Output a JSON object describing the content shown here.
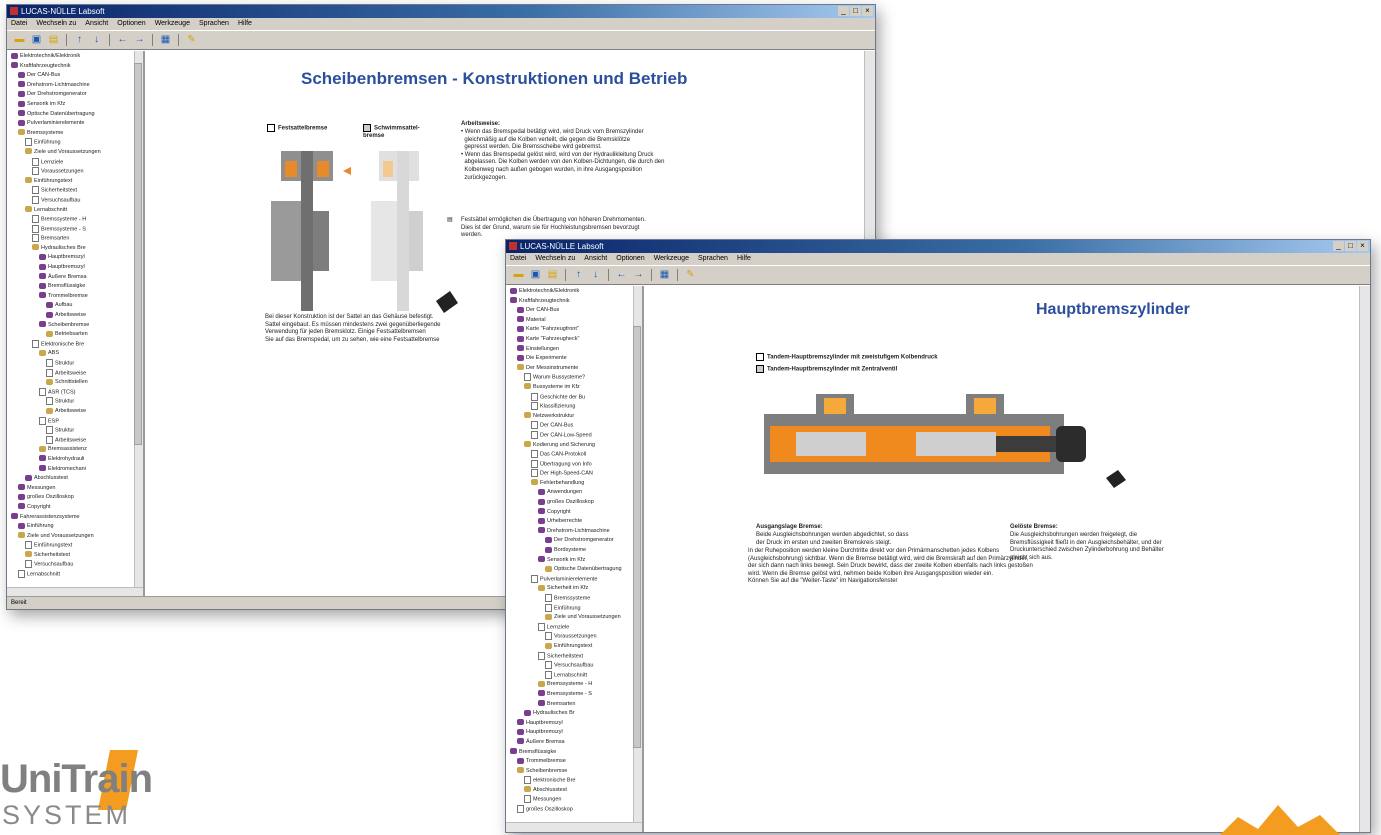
{
  "window1": {
    "title": "LUCAS-NÜLLE Labsoft",
    "menu": [
      "Datei",
      "Wechseln zu",
      "Ansicht",
      "Optionen",
      "Werkzeuge",
      "Sprachen",
      "Hilfe"
    ],
    "tree": [
      "Elektrotechnik/Elektronik",
      "Kraftfahrzeugtechnik",
      "Der CAN-Bus",
      "Drehstrom-Lichtmaschine",
      "Der Drehstromgenerator",
      "Sensorik im Kfz",
      "Optische Datenübertragung",
      "Pulverlaminierelemente",
      "Bremssysteme",
      "Einführung",
      "Ziele und Voraussetzungen",
      "Lernziele",
      "Voraussetzungen",
      "Einführungstext",
      "Sicherheitstext",
      "Versuchsaufbau",
      "Lernabschnitt",
      "Bremssysteme - H",
      "Bremssysteme - S",
      "Bremsarten",
      "Hydraulisches Bre",
      "Hauptbremszyl",
      "Hauptbremszyl",
      "Äußere Bremsa",
      "Bremsflüssigke",
      "Trommelbremse",
      "Aufbau",
      "Arbeitsweise",
      "Scheibenbremse",
      "Betriebsarten",
      "Elektronische Bre",
      "ABS",
      "Struktur",
      "Arbeitsweise",
      "Schnittstellen",
      "ASR (TCS)",
      "Struktur",
      "Arbeitsweise",
      "ESP",
      "Struktur",
      "Arbeitsweise",
      "Bremsassistenz",
      "Elektrohydrauli",
      "Elektromechani",
      "Abschlusstest",
      "Messungen",
      "großes Oszilloskop",
      "Copyright",
      "Fahrerassistenzsysteme",
      "Einführung",
      "Ziele und Voraussetzungen",
      "Einführungstext",
      "Sicherheitstext",
      "Versuchsaufbau",
      "Lernabschnitt"
    ],
    "status": "Bereit",
    "page": {
      "title": "Scheibenbremsen - Konstruktionen und Betrieb",
      "option1": "Festsattelbremse",
      "option2": "Schwimmsattel-bremse",
      "work_heading": "Arbeitsweise:",
      "work_lines": [
        "• Wenn das Bremspedal betätigt wird, wird Druck vom Bremszylinder",
        "  gleichmäßig auf die Kolben verteilt, die gegen die Bremsklötze",
        "  gepresst werden. Die Bremsscheibe wird gebremst.",
        "• Wenn das Bremspedal gelöst wird, wird von der Hydraulikleitung Druck",
        "  abgelassen. Die Kolben werden von den Kolben-Dichtungen, die durch den",
        "  Kolbenweg nach außen gebogen wurden, in ihre Ausgangsposition",
        "  zurückgezogen."
      ],
      "note_lines": [
        "Festsättel ermöglichen die Übertragung von höheren Drehmomenten.",
        "Dies ist der Grund, warum sie für Hochleistungsbremsen bevorzugt",
        "werden."
      ],
      "bottom_lines": [
        "Bei dieser Konstruktion ist der Sattel an das Gehäuse befestigt.",
        "Sattel eingebaut. Es müssen mindestens zwei gegenüberliegende",
        "Verwendung für jeden Bremsklotz. Einige Festsattelbremsen",
        "Sie auf das Bremspedal, um zu sehen, wie eine Festsattelbremse"
      ]
    }
  },
  "window2": {
    "title": "LUCAS-NÜLLE Labsoft",
    "menu": [
      "Datei",
      "Wechseln zu",
      "Ansicht",
      "Optionen",
      "Werkzeuge",
      "Sprachen",
      "Hilfe"
    ],
    "tree": [
      "Elektrotechnik/Elektronik",
      "Kraftfahrzeugtechnik",
      "Der CAN-Bus",
      "Material",
      "Karte \"Fahrzeugfront\"",
      "Karte \"Fahrzeugheck\"",
      "Einstellungen",
      "Die Experimente",
      "Der Messinstrumente",
      "Warum Bussysteme?",
      "Bussysteme im Kfz",
      "Geschichte der Bu",
      "Klassifizierung",
      "Netzwerkstruktur",
      "Der CAN-Bus",
      "Der CAN-Low-Speed",
      "Kodierung und Sicherung",
      "Das CAN-Protokoll",
      "Übertragung von Info",
      "Der High-Speed-CAN",
      "Fehlerbehandlung",
      "Anwendungen",
      "großes Oszilloskop",
      "Copyright",
      "Urheberrechte",
      "Drehstrom-Lichtmaschine",
      "Der Drehstromgenerator",
      "Bordsysteme",
      "Sensorik im Kfz",
      "Optische Datenübertragung",
      "Pulverlaminierelemente",
      "Sicherheit im Kfz",
      "Bremssysteme",
      "Einführung",
      "Ziele und Voraussetzungen",
      "Lernziele",
      "Voraussetzungen",
      "Einführungstext",
      "Sicherheitstext",
      "Versuchsaufbau",
      "Lernabschnitt",
      "Bremssysteme - H",
      "Bremssysteme - S",
      "Bremsarten",
      "Hydraulisches Br",
      "Hauptbremszyl",
      "Hauptbremszyl",
      "Äußere Bremsa",
      "Bremsflüssigke",
      "Trommelbremse",
      "Scheibenbremse",
      "elektronische Bre",
      "Abschlusstest",
      "Messungen",
      "großes Oszilloskop"
    ],
    "page": {
      "title": "Hauptbremszylinder",
      "option1": "Tandem-Hauptbremszylinder mit zweistufigem Kolbendruck",
      "option2": "Tandem-Hauptbremszylinder mit Zentralventil",
      "left_heading": "Ausgangslage Bremse:",
      "left_lines": [
        "Beide Ausgleichsbohrungen werden abgedichtet, so dass",
        "der Druck im ersten und zweiten Bremskreis steigt."
      ],
      "right_heading": "Gelöste Bremse:",
      "right_lines": [
        "Die Ausgleichsbohrungen werden freigelegt, die",
        "Bremsflüssigkeit fließt in den Ausgleichsbehälter, und der",
        "Druckunterschied zwischen Zylinderbohrung und Behälter",
        "gleicht sich aus."
      ],
      "body_lines": [
        "In der Ruheposition werden kleine Durchtritte direkt vor den Primärmanschetten jedes Kolbens",
        "(Ausgleichsbohrung) sichtbar. Wenn die Bremse betätigt wird, wird die Bremskraft auf den Primärzylinder,",
        "der sich dann nach links bewegt. Sein Druck bewirkt, dass der zweite Kolben ebenfalls nach links gestoßen",
        "wird. Wenn die Bremse gelöst wird, nehmen beide Kolben ihre Ausgangsposition wieder ein.",
        "Können Sie auf die \"Weiter-Taste\" im Navigationsfenster"
      ]
    }
  },
  "logo": {
    "line1": "UniTrain",
    "line2": "SYSTEM",
    "accent": "#f39c1f"
  }
}
